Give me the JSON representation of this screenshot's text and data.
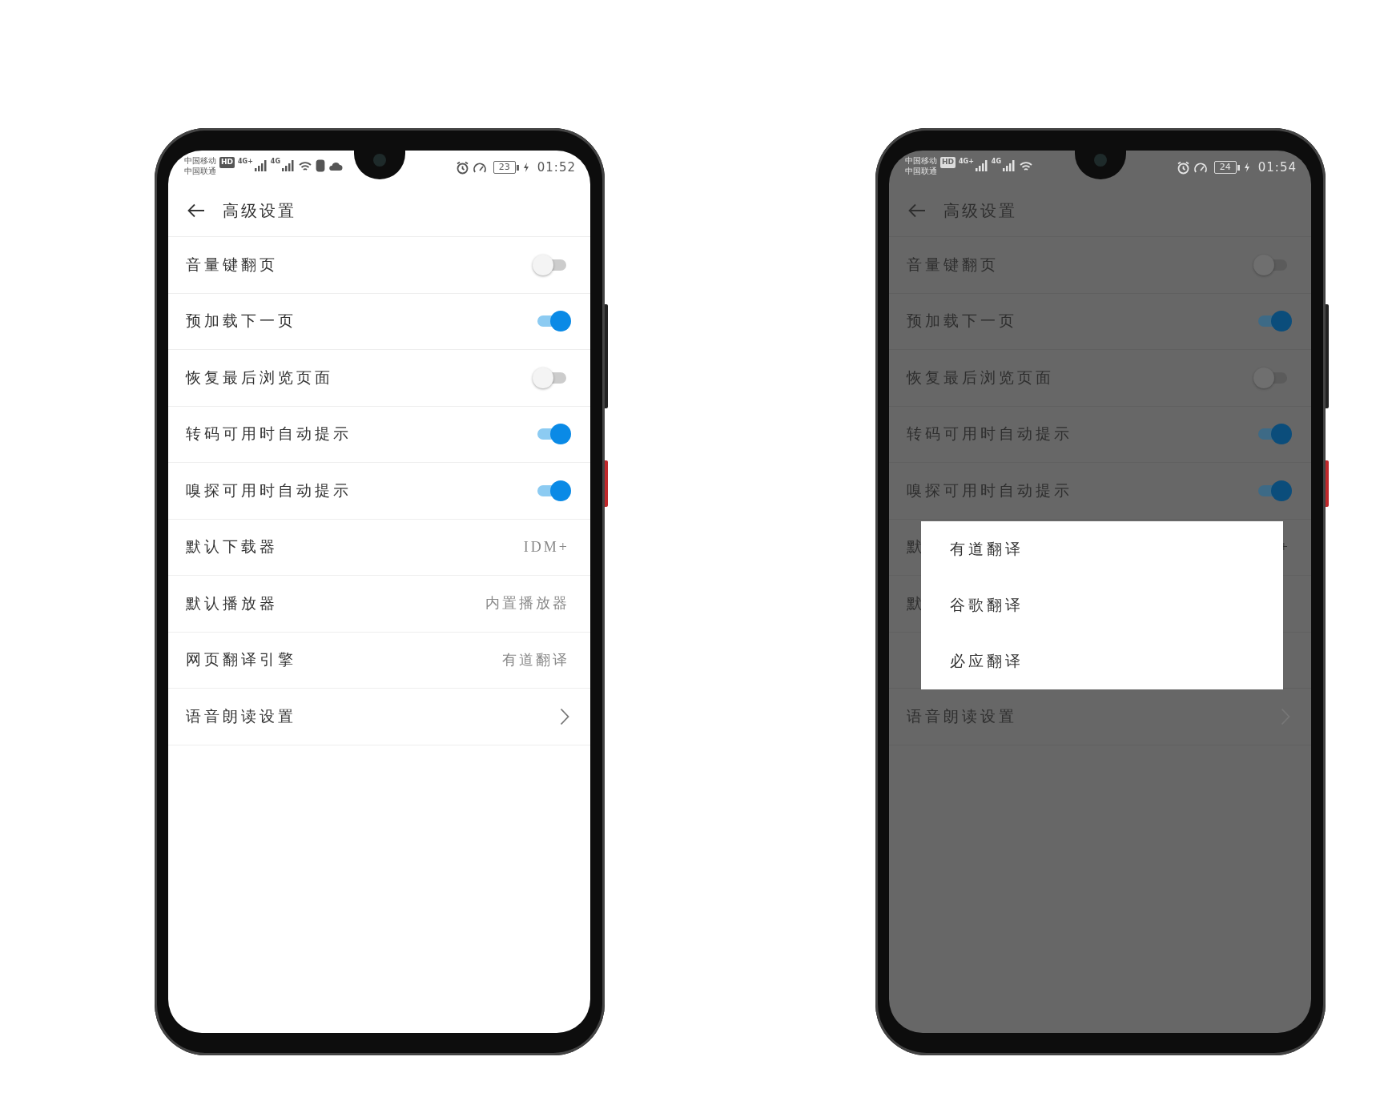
{
  "phones": [
    {
      "dimmed": false,
      "status_bar": {
        "carriers": [
          "中国移动",
          "中国联通"
        ],
        "hd": "HD",
        "network_1": "4G+",
        "network_2": "4G",
        "notifications": [
          {
            "kind": "device"
          },
          {
            "kind": "cloud"
          }
        ],
        "battery": "23",
        "time": "01:52"
      },
      "header": {
        "title": "高级设置"
      },
      "rows": [
        {
          "kind": "toggle",
          "label": "音量键翻页",
          "on": false
        },
        {
          "kind": "toggle",
          "label": "预加载下一页",
          "on": true
        },
        {
          "kind": "toggle",
          "label": "恢复最后浏览页面",
          "on": false
        },
        {
          "kind": "toggle",
          "label": "转码可用时自动提示",
          "on": true
        },
        {
          "kind": "toggle",
          "label": "嗅探可用时自动提示",
          "on": true
        },
        {
          "kind": "value",
          "label": "默认下载器",
          "value": "IDM+"
        },
        {
          "kind": "value",
          "label": "默认播放器",
          "value": "内置播放器"
        },
        {
          "kind": "value",
          "label": "网页翻译引擎",
          "value": "有道翻译"
        },
        {
          "kind": "link",
          "label": "语音朗读设置"
        }
      ]
    },
    {
      "dimmed": true,
      "status_bar": {
        "carriers": [
          "中国移动",
          "中国联通"
        ],
        "hd": "HD",
        "network_1": "4G+",
        "network_2": "4G",
        "battery": "24",
        "time": "01:54"
      },
      "header": {
        "title": "高级设置"
      },
      "rows": [
        {
          "kind": "toggle",
          "label": "音量键翻页",
          "on": false
        },
        {
          "kind": "toggle",
          "label": "预加载下一页",
          "on": true
        },
        {
          "kind": "toggle",
          "label": "恢复最后浏览页面",
          "on": false
        },
        {
          "kind": "toggle",
          "label": "转码可用时自动提示",
          "on": true
        },
        {
          "kind": "toggle",
          "label": "嗅探可用时自动提示",
          "on": true
        },
        {
          "kind": "value",
          "label": "默",
          "value": "+"
        },
        {
          "kind": "value",
          "label": "默"
        },
        {
          "kind": "value"
        },
        {
          "kind": "link",
          "label": "语音朗读设置"
        }
      ],
      "dialog": {
        "options": [
          "有道翻译",
          "谷歌翻译",
          "必应翻译"
        ]
      }
    }
  ]
}
